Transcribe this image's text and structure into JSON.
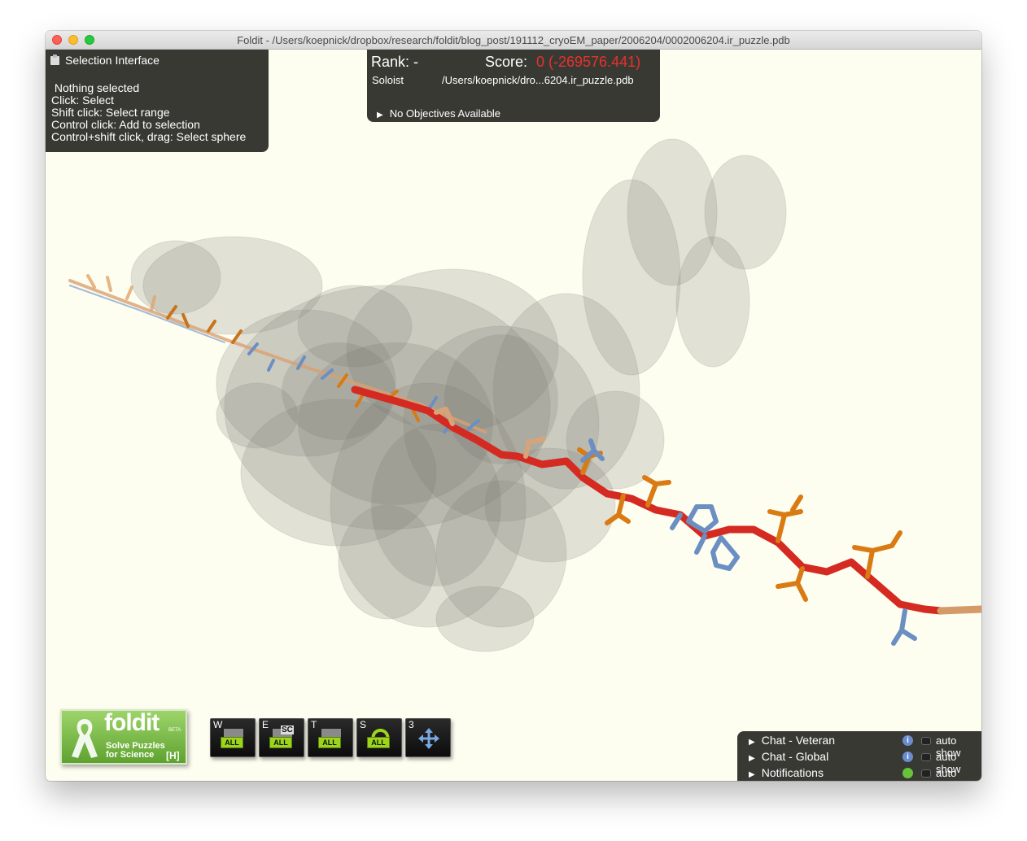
{
  "window": {
    "title": "Foldit - /Users/koepnick/dropbox/research/foldit/blog_post/191112_cryoEM_paper/2006204/0002006204.ir_puzzle.pdb"
  },
  "selection_panel": {
    "title": "Selection Interface",
    "status": " Nothing selected",
    "hints": [
      "Click: Select",
      "Shift click: Select range",
      "Control click: Add to selection",
      "Control+shift click, drag: Select sphere"
    ]
  },
  "score_panel": {
    "rank_label": "Rank: -",
    "score_label": "Score:",
    "score_value": "0 (-269576.441)",
    "mode": "Soloist",
    "file_path": "/Users/koepnick/dro...6204.ir_puzzle.pdb",
    "objectives": "No Objectives Available"
  },
  "logo": {
    "word": "foldit",
    "beta": "BETA",
    "tagline_1": "Solve Puzzles",
    "tagline_2": "for Science",
    "help_key": "[H]"
  },
  "toolbar": [
    {
      "key": "W",
      "badge": "ALL",
      "icon": "wiggle-icon"
    },
    {
      "key": "E",
      "badge": "ALL",
      "extra": "SC",
      "icon": "shake-sidechains-icon"
    },
    {
      "key": "T",
      "badge": "ALL",
      "icon": "tweak-icon"
    },
    {
      "key": "S",
      "badge": "ALL",
      "icon": "rotate-icon"
    },
    {
      "key": "3",
      "icon": "move-arrows-icon"
    }
  ],
  "chat": [
    {
      "label": "Chat - Veteran",
      "auto": "auto show"
    },
    {
      "label": "Chat - Global",
      "auto": "auto show"
    },
    {
      "label": "Notifications",
      "auto": "auto show"
    }
  ],
  "colors": {
    "background": "#fdfdf0",
    "score_red": "#e8312c",
    "backbone_red": "#d42a22",
    "sidechain_orange": "#d97a12",
    "sidechain_blue": "#6b8fc2",
    "density_gray": "#8c8c86"
  }
}
